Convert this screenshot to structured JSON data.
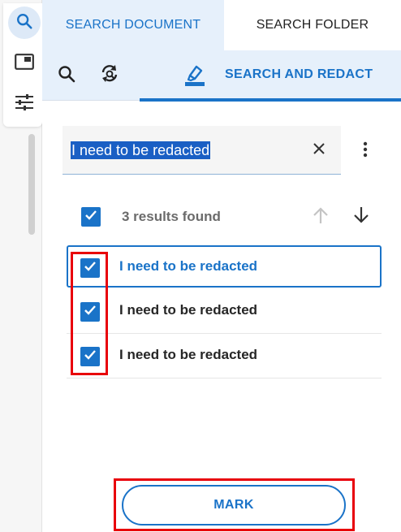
{
  "rail": {
    "items": [
      {
        "icon": "search-icon"
      },
      {
        "icon": "thumbnail-panel-icon"
      },
      {
        "icon": "tune-sliders-icon"
      }
    ]
  },
  "tabs": {
    "search_document": "SEARCH DOCUMENT",
    "search_folder": "SEARCH FOLDER"
  },
  "toolbar": {
    "search_redact_label": "SEARCH AND REDACT"
  },
  "search": {
    "value": "I need to be redacted"
  },
  "results": {
    "count_label": "3 results found",
    "items": [
      {
        "label": "I need to be redacted",
        "checked": true
      },
      {
        "label": "I need to be redacted",
        "checked": true
      },
      {
        "label": "I need to be redacted",
        "checked": true
      }
    ]
  },
  "actions": {
    "mark_label": "MARK"
  },
  "colors": {
    "accent": "#1a73c8",
    "highlight_box": "#e8000a"
  }
}
